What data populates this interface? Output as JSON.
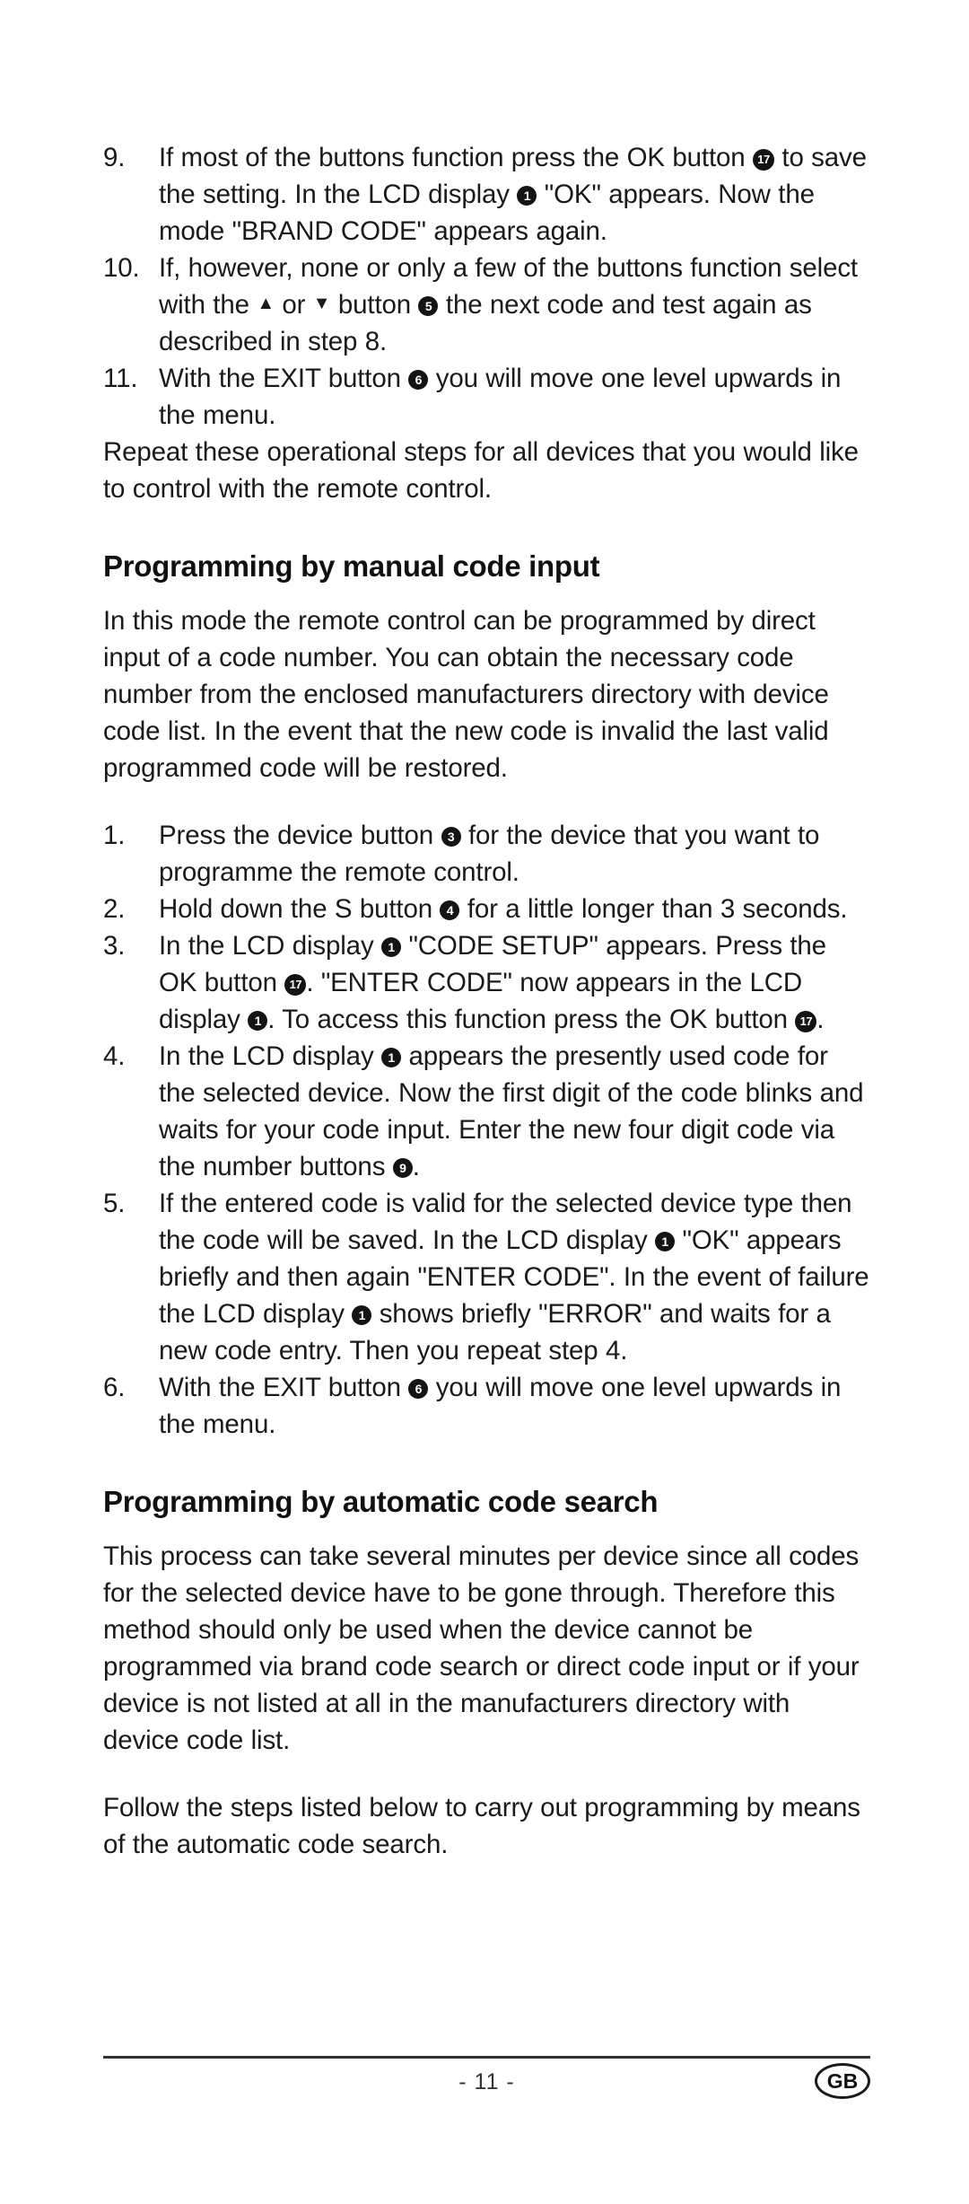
{
  "document": {
    "page_label": "- 11 -",
    "locale_badge": "GB"
  },
  "steps_continued": {
    "items": [
      {
        "number": "9.",
        "segments": [
          {
            "t": "text",
            "v": "If most of the buttons function press the OK button "
          },
          {
            "t": "badge",
            "v": "17"
          },
          {
            "t": "text",
            "v": " to save the setting. In the LCD display "
          },
          {
            "t": "badge",
            "v": "1"
          },
          {
            "t": "text",
            "v": " \"OK\" appears. Now the mode \"BRAND CODE\" appears again."
          }
        ]
      },
      {
        "number": "10.",
        "segments": [
          {
            "t": "text",
            "v": "If, however, none or only a few of the buttons function select with the "
          },
          {
            "t": "arrow",
            "v": "▲"
          },
          {
            "t": "text",
            "v": " or "
          },
          {
            "t": "arrow",
            "v": "▼"
          },
          {
            "t": "text",
            "v": " button "
          },
          {
            "t": "badge",
            "v": "5"
          },
          {
            "t": "text",
            "v": " the next code and test again as described in step 8."
          }
        ]
      },
      {
        "number": "11.",
        "segments": [
          {
            "t": "text",
            "v": "With the EXIT button "
          },
          {
            "t": "badge",
            "v": "6"
          },
          {
            "t": "text",
            "v": " you will move one level upwards in the menu."
          }
        ]
      }
    ],
    "closing_paragraph": "Repeat these operational steps for all devices that you would like to control with the remote control."
  },
  "section_manual": {
    "heading": "Programming by manual code input",
    "intro": "In this mode the remote control can be programmed by direct input of a code number. You can obtain the necessary code number from the enclosed manufacturers directory with device code list. In the event that the new code is invalid the last valid programmed code will be restored.",
    "items": [
      {
        "number": "1.",
        "segments": [
          {
            "t": "text",
            "v": "Press the device button "
          },
          {
            "t": "badge",
            "v": "3"
          },
          {
            "t": "text",
            "v": " for the device that you want to programme the remote control."
          }
        ]
      },
      {
        "number": "2.",
        "segments": [
          {
            "t": "text",
            "v": "Hold down the S button "
          },
          {
            "t": "badge",
            "v": "4"
          },
          {
            "t": "text",
            "v": " for a little longer than 3 seconds."
          }
        ]
      },
      {
        "number": "3.",
        "segments": [
          {
            "t": "text",
            "v": "In the LCD display "
          },
          {
            "t": "badge",
            "v": "1"
          },
          {
            "t": "text",
            "v": " \"CODE SETUP\" appears. Press the OK button "
          },
          {
            "t": "badge",
            "v": "17"
          },
          {
            "t": "text",
            "v": ". \"ENTER CODE\" now appears in the LCD display "
          },
          {
            "t": "badge",
            "v": "1"
          },
          {
            "t": "text",
            "v": ". To access this function press the OK button "
          },
          {
            "t": "badge",
            "v": "17"
          },
          {
            "t": "text",
            "v": "."
          }
        ]
      },
      {
        "number": "4.",
        "segments": [
          {
            "t": "text",
            "v": "In the LCD display "
          },
          {
            "t": "badge",
            "v": "1"
          },
          {
            "t": "text",
            "v": " appears the presently used code for the selected device. Now the first digit of the code blinks and waits for your code input. Enter the new four digit code via the number buttons "
          },
          {
            "t": "badge",
            "v": "9"
          },
          {
            "t": "text",
            "v": "."
          }
        ]
      },
      {
        "number": "5.",
        "segments": [
          {
            "t": "text",
            "v": "If the entered code is valid for the selected device type then the code will be saved. In the LCD display "
          },
          {
            "t": "badge",
            "v": "1"
          },
          {
            "t": "text",
            "v": " \"OK\" appears briefly and then again \"ENTER CODE\". In the event of failure the LCD display "
          },
          {
            "t": "badge",
            "v": "1"
          },
          {
            "t": "text",
            "v": " shows briefly \"ERROR\" and waits for a new code entry. Then you repeat step 4."
          }
        ]
      },
      {
        "number": "6.",
        "segments": [
          {
            "t": "text",
            "v": "With the EXIT button "
          },
          {
            "t": "badge",
            "v": "6"
          },
          {
            "t": "text",
            "v": " you will move one level upwards in the menu."
          }
        ]
      }
    ]
  },
  "section_automatic": {
    "heading": "Programming by automatic code search",
    "paragraph_1": "This process can take several minutes per device since all codes for the selected device have to be gone through. Therefore this method should only be used when the device cannot be programmed via brand code search or direct code input or if your device is not listed at all in the manufacturers directory with device code list.",
    "paragraph_2": "Follow the steps listed below to carry out programming by means of the automatic code search."
  }
}
